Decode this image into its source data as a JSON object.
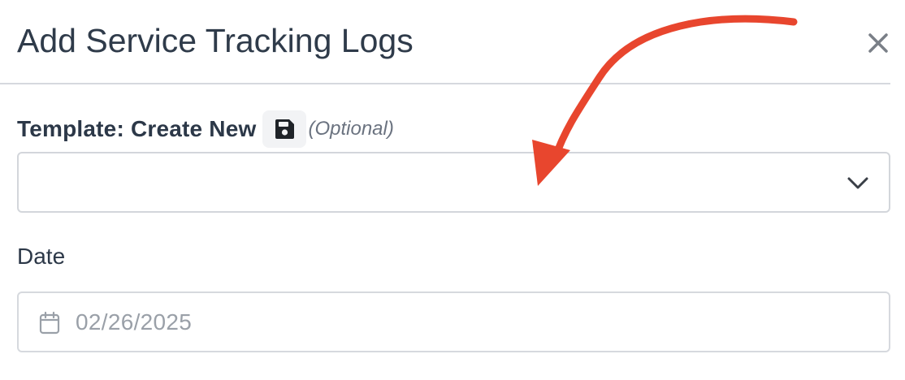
{
  "dialog": {
    "title": "Add Service Tracking Logs",
    "close_icon": "close-icon"
  },
  "template": {
    "label": "Template: Create New",
    "save_icon": "floppy-disk-icon",
    "optional_text": "(Optional)",
    "selected_value": "",
    "dropdown_icon": "chevron-down-icon"
  },
  "date": {
    "label": "Date",
    "value": "02/26/2025",
    "icon": "calendar-icon"
  },
  "annotation": {
    "arrow_color": "#e8462e"
  }
}
